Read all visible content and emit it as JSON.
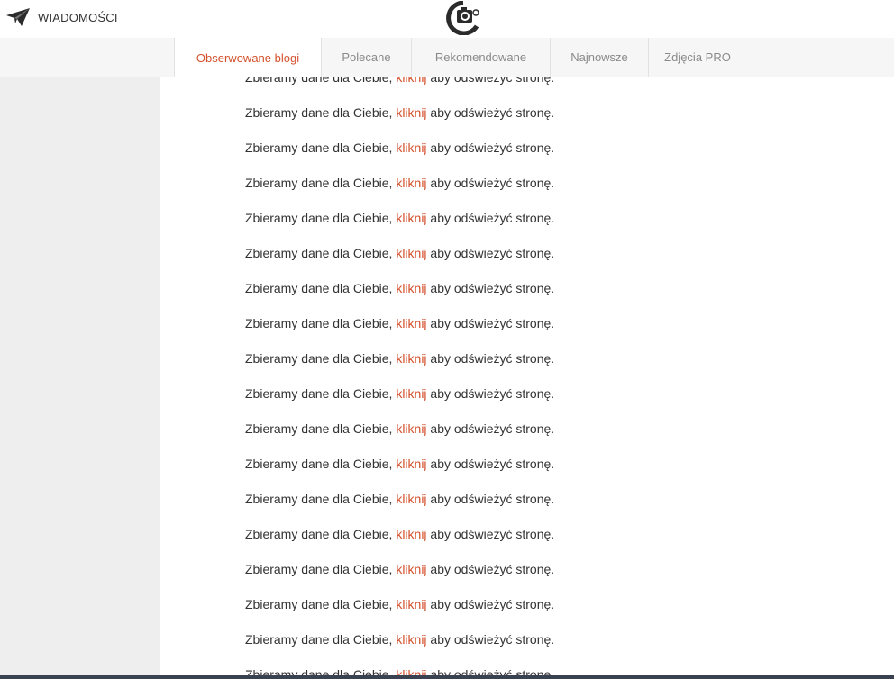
{
  "header": {
    "messages_label": "WIADOMOŚCI",
    "messages_icon": "paper-plane-icon",
    "logo_icon": "camera-logo-icon"
  },
  "tabs": [
    {
      "label": "Obserwowane blogi",
      "active": true
    },
    {
      "label": "Polecane",
      "active": false
    },
    {
      "label": "Rekomendowane",
      "active": false
    },
    {
      "label": "Najnowsze",
      "active": false
    },
    {
      "label": "Zdjęcia PRO",
      "active": false
    }
  ],
  "feed": {
    "message_before": "Zbieramy dane dla Ciebie, ",
    "link_text": "kliknij",
    "message_after": " aby odświeżyć stronę.",
    "item_count": 18
  },
  "colors": {
    "accent": "#d4502b",
    "text": "#333333",
    "sidebar": "#eeeeee",
    "tabbar": "#f6f6f6"
  }
}
